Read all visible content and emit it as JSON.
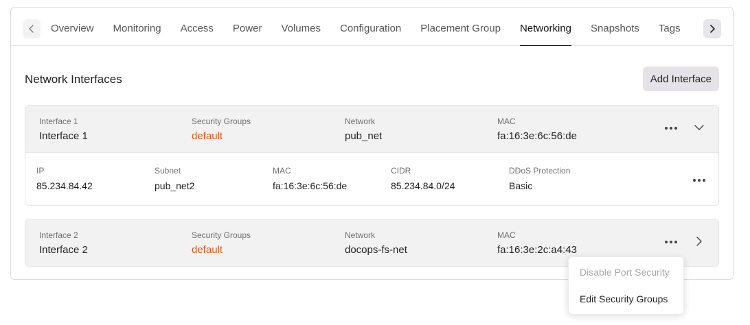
{
  "tabs": [
    {
      "label": "Overview",
      "active": false
    },
    {
      "label": "Monitoring",
      "active": false
    },
    {
      "label": "Access",
      "active": false
    },
    {
      "label": "Power",
      "active": false
    },
    {
      "label": "Volumes",
      "active": false
    },
    {
      "label": "Configuration",
      "active": false
    },
    {
      "label": "Placement Group",
      "active": false
    },
    {
      "label": "Networking",
      "active": true
    },
    {
      "label": "Snapshots",
      "active": false
    },
    {
      "label": "Tags",
      "active": false
    }
  ],
  "section": {
    "title": "Network Interfaces",
    "add_button": "Add Interface"
  },
  "interfaces": [
    {
      "name_label": "Interface 1",
      "name": "Interface 1",
      "sg_label": "Security Groups",
      "sg": "default",
      "network_label": "Network",
      "network": "pub_net",
      "mac_label": "MAC",
      "mac": "fa:16:3e:6c:56:de",
      "expanded": true,
      "details": {
        "ip_label": "IP",
        "ip": "85.234.84.42",
        "subnet_label": "Subnet",
        "subnet": "pub_net2",
        "mac_label": "MAC",
        "mac": "fa:16:3e:6c:56:de",
        "cidr_label": "CIDR",
        "cidr": "85.234.84.0/24",
        "ddos_label": "DDoS Protection",
        "ddos": "Basic"
      }
    },
    {
      "name_label": "Interface 2",
      "name": "Interface 2",
      "sg_label": "Security Groups",
      "sg": "default",
      "network_label": "Network",
      "network": "docops-fs-net",
      "mac_label": "MAC",
      "mac": "fa:16:3e:2c:a4:43",
      "expanded": false
    }
  ],
  "context_menu": {
    "items": [
      {
        "label": "Disable Port Security",
        "disabled": true
      },
      {
        "label": "Edit Security Groups",
        "disabled": false
      }
    ]
  },
  "icons": {
    "tab_prev": "chevron-left-icon",
    "tab_next": "chevron-right-icon",
    "more": "more-horizontal-icon",
    "collapse": "chevron-down-icon",
    "expand": "chevron-right-icon"
  },
  "colors": {
    "accent_orange": "#e8561c",
    "panel_bg": "#f2f2f2",
    "button_bg": "#e5e3e8"
  }
}
